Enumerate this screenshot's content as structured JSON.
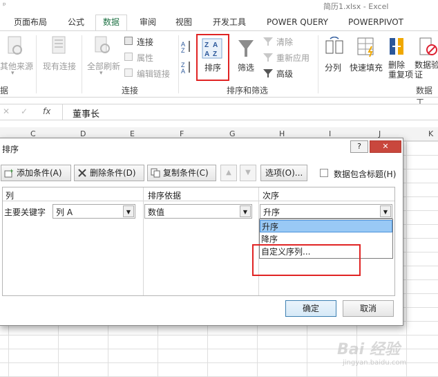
{
  "window": {
    "title": "简历1.xlsx - Excel",
    "quick_access": "ᵖ"
  },
  "tabs": [
    "页面布局",
    "公式",
    "数据",
    "审阅",
    "视图",
    "开发工具",
    "POWER QUERY",
    "POWERPIVOT"
  ],
  "active_tab": "数据",
  "ribbon": {
    "get_external": {
      "other_sources": "其他来源",
      "existing_connections": "现有连接",
      "group_label": "据"
    },
    "connections": {
      "refresh_all": "全部刷新",
      "connections": "连接",
      "properties": "属性",
      "edit_links": "编辑链接",
      "group_label": "连接"
    },
    "sort_filter": {
      "sort": "排序",
      "filter": "筛选",
      "clear": "清除",
      "reapply": "重新应用",
      "advanced": "高级",
      "group_label": "排序和筛选"
    },
    "data_tools": {
      "text_to_columns": "分列",
      "flash_fill": "快速填充",
      "remove_dupes": "删除\n重复项",
      "validation": "数据验\n证",
      "group_label": "数据工"
    }
  },
  "formula_bar": {
    "fx": "fx",
    "content": "董事长"
  },
  "columns": [
    "C",
    "D",
    "E",
    "F",
    "G",
    "H",
    "I",
    "J",
    "K"
  ],
  "dialog": {
    "title": "排序",
    "help": "?",
    "close": "✕",
    "toolbar": {
      "add": "添加条件(A)",
      "delete": "删除条件(D)",
      "copy": "复制条件(C)",
      "options": "选项(O)...",
      "has_header": "数据包含标题(H)"
    },
    "headers": {
      "col": "列",
      "sort_on": "排序依据",
      "order": "次序"
    },
    "row": {
      "label": "主要关键字",
      "column": "列 A",
      "sort_on": "数值",
      "order": "升序"
    },
    "order_options": [
      "升序",
      "降序",
      "自定义序列..."
    ],
    "selected_option": "升序",
    "ok": "确定",
    "cancel": "取消"
  },
  "watermark": {
    "main": "Bai 经验",
    "sub": "jingyan.baidu.com"
  },
  "colors": {
    "accent": "#217346",
    "highlight": "#e02323",
    "selection": "#99c9f5"
  }
}
